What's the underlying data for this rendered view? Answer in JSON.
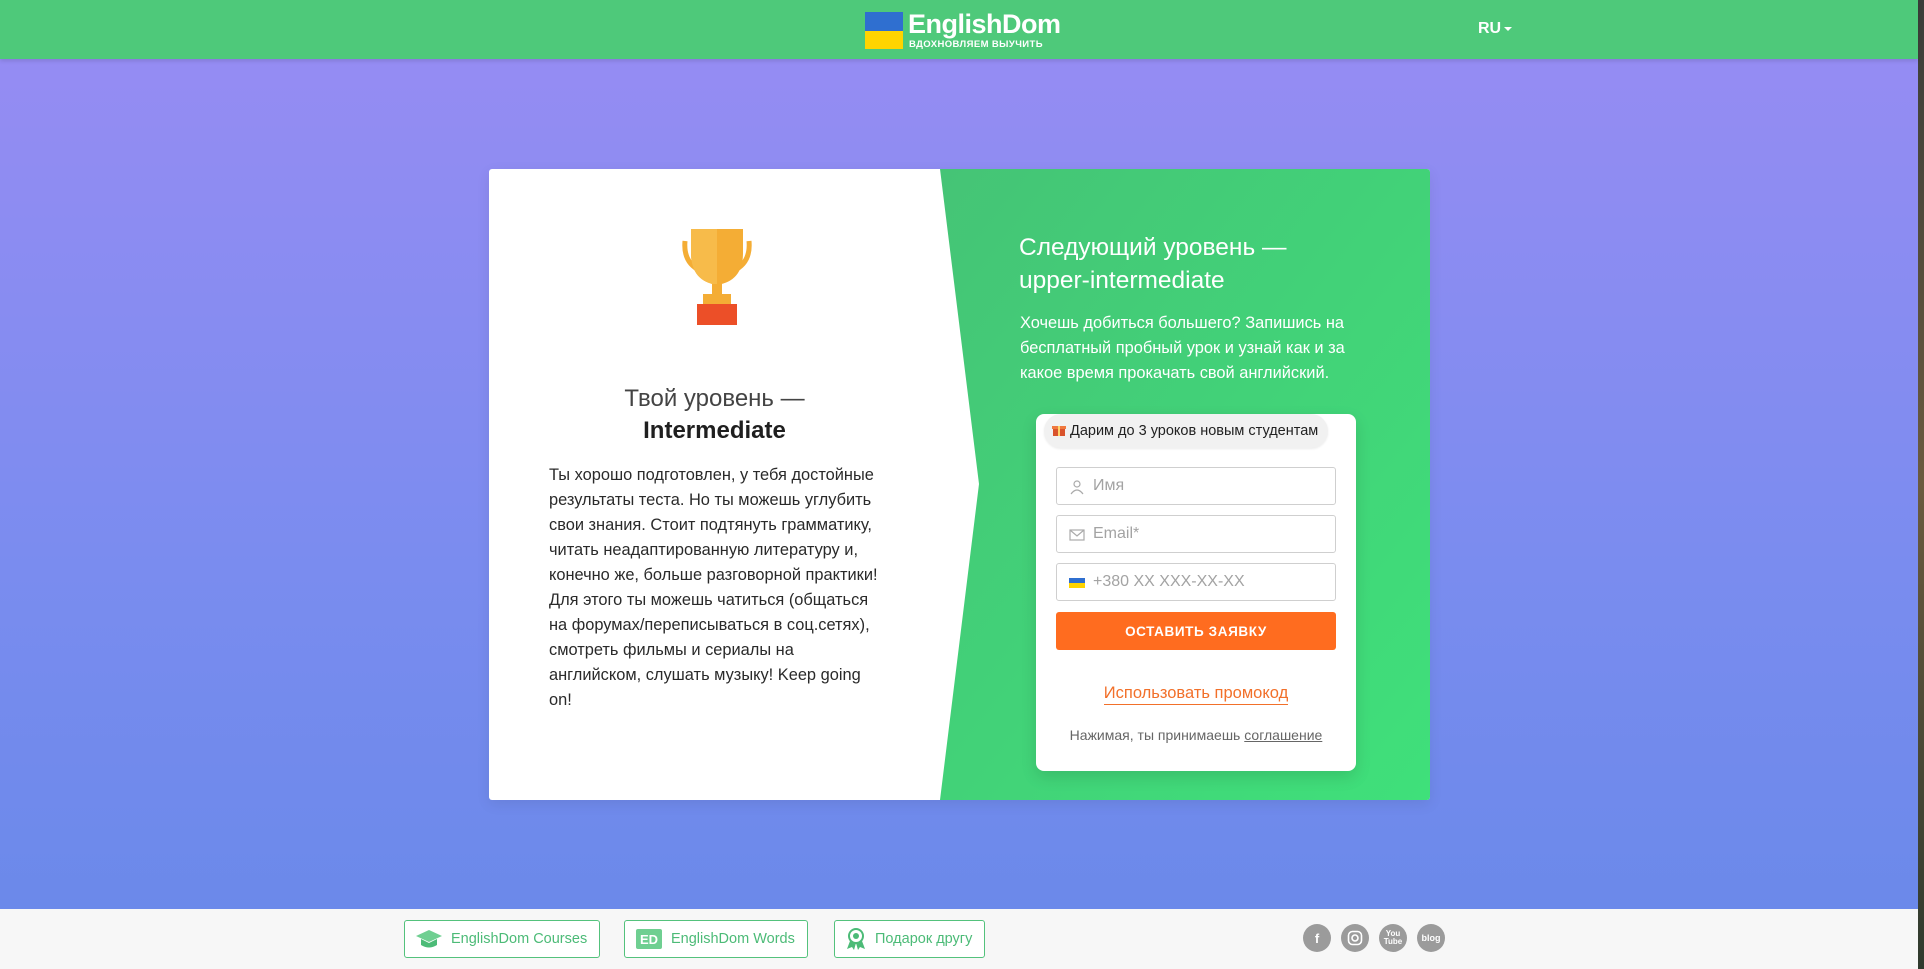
{
  "header": {
    "logo_title": "EnglishDom",
    "logo_subtitle": "ВДОХНОВЛЯЕМ ВЫУЧИТЬ",
    "language": "RU"
  },
  "result": {
    "title_prefix": "Твой уровень —",
    "level": "Intermediate",
    "description": "Ты хорошо подготовлен, у тебя достойные результаты теста. Но ты можешь углубить свои знания. Стоит подтянуть грамматику, читать неадаптированную литературу и, конечно же, больше разговорной практики! Для этого ты можешь чатиться (общаться на форумах/переписываться в соц.сетях), смотреть фильмы и сериалы на английском, слушать музыку! Keep going on!"
  },
  "next": {
    "title": "Следующий уровень — upper-intermediate",
    "text": "Хочешь добиться большего? Запишись на бесплатный пробный урок и узнай как и за какое время прокачать свой английский."
  },
  "form": {
    "badge": "Дарим до 3 уроков новым студентам",
    "name_placeholder": "Имя",
    "email_placeholder": "Email*",
    "phone_placeholder": "+380 XX XXX-XX-XX",
    "submit_label": "ОСТАВИТЬ ЗАЯВКУ",
    "promo_label": "Использовать промокод",
    "agree_text": "Нажимая, ты принимаешь",
    "agree_link": "соглашение"
  },
  "footer": {
    "courses_label": "EnglishDom Courses",
    "words_label": "EnglishDom Words",
    "gift_label": "Подарок другу",
    "social": [
      "facebook-icon",
      "instagram-icon",
      "youtube-icon",
      "blog-icon"
    ]
  },
  "colors": {
    "header_green": "#4ec97a",
    "accent_orange": "#ff6c1f",
    "bg_purple": "#958cf3"
  }
}
